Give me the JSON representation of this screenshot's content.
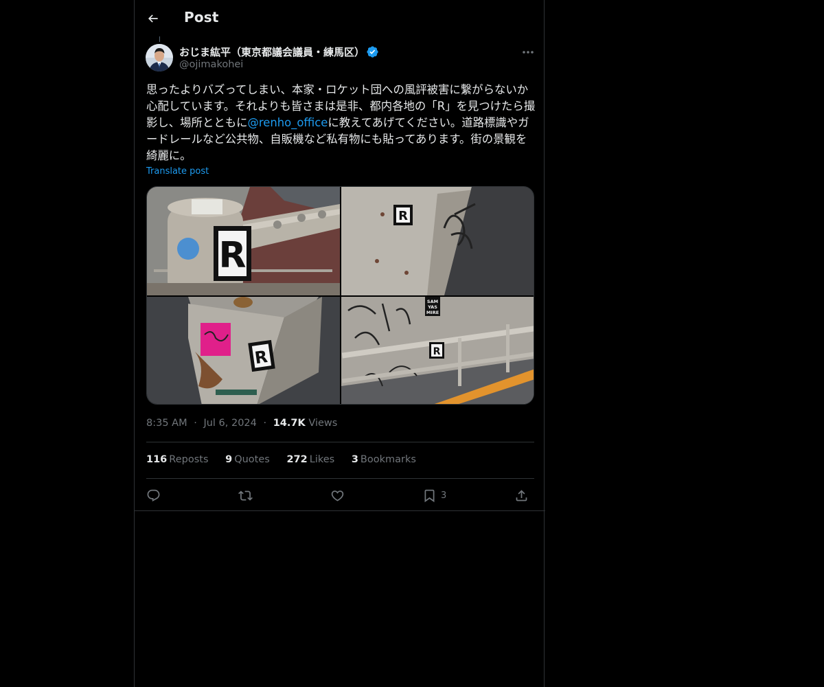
{
  "header": {
    "title": "Post"
  },
  "author": {
    "display_name": "おじま紘平（東京都議会議員・練馬区）",
    "handle": "@ojimakohei"
  },
  "post": {
    "text_before": "思ったよりバズってしまい、本家・ロケット団への風評被害に繋がらないか心配しています。それよりも皆さまは是非、都内各地の「R」を見つけたら撮影し、場所とともに",
    "mention": "@renho_office",
    "text_after": "に教えてあげてください。道路標識やガードレールなど公共物、自販機など私有物にも貼ってあります。街の景観を綺麗に。",
    "translate": "Translate post"
  },
  "meta": {
    "time": "8:35 AM",
    "sep1": "·",
    "date": "Jul 6, 2024",
    "sep2": "·",
    "views": "14.7K",
    "views_label": "Views"
  },
  "stats": {
    "reposts": "116",
    "reposts_label": "Reposts",
    "quotes": "9",
    "quotes_label": "Quotes",
    "likes": "272",
    "likes_label": "Likes",
    "bookmarks": "3",
    "bookmarks_label": "Bookmarks"
  },
  "actions": {
    "bookmark_count": "3"
  },
  "images": {
    "sticker_letter": "R",
    "sticker_text_1": "SAM",
    "sticker_text_2": "YAS",
    "sticker_text_3": "MIRE"
  },
  "colors": {
    "accent": "#1d9bf0",
    "muted": "#71767b",
    "border": "#2f3336",
    "background": "#000000"
  }
}
